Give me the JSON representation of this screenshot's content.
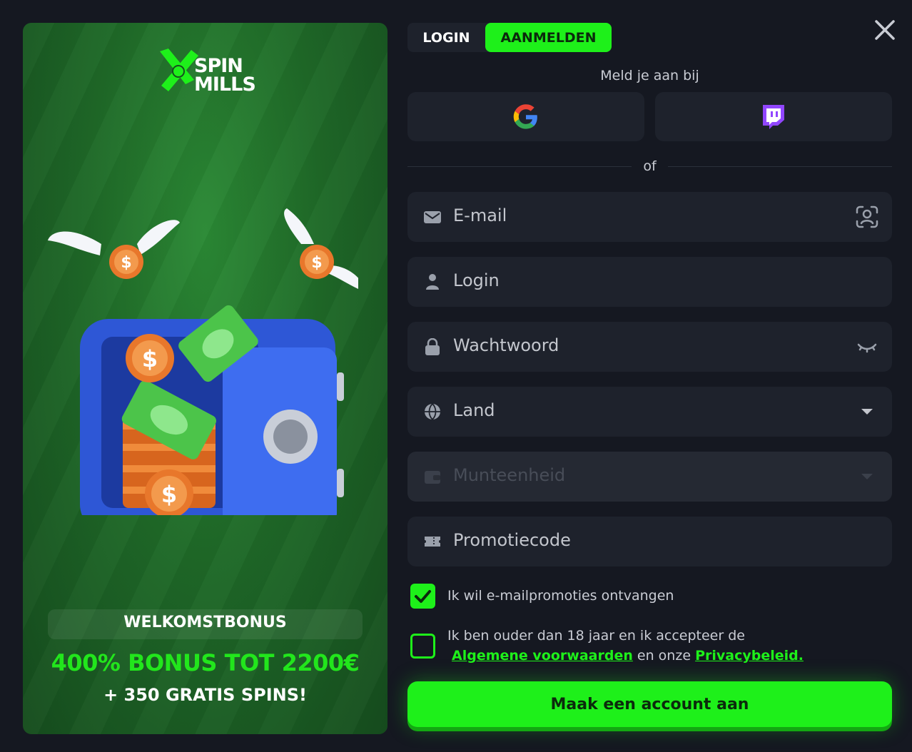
{
  "promo": {
    "logo_line1": "SPIN",
    "logo_line2": "MILLS",
    "bonus_title": "WELKOMSTBONUS",
    "bonus_main": "400% BONUS TOT 2200€",
    "bonus_sub": "+ 350 GRATIS SPINS!"
  },
  "tabs": {
    "login": "LOGIN",
    "signup": "AANMELDEN"
  },
  "subtitle": "Meld je aan bij",
  "divider_text": "of",
  "fields": {
    "email": "E-mail",
    "login": "Login",
    "password": "Wachtwoord",
    "country": "Land",
    "currency": "Munteenheid",
    "promo": "Promotiecode"
  },
  "checks": {
    "promo_text": "Ik wil e-mailpromoties ontvangen",
    "terms_text_1": "Ik ben ouder dan 18 jaar en ik accepteer de",
    "terms_link": "Algemene voorwaarden",
    "terms_mid": "en onze",
    "privacy_link": "Privacybeleid."
  },
  "submit": "Maak een account aan",
  "colors": {
    "accent": "#1ef01a",
    "background": "#151821",
    "field": "#1e222c",
    "promo_green": "#1f6a28"
  },
  "icons": [
    "close-icon",
    "google-icon",
    "twitch-icon",
    "mail-icon",
    "face-id-icon",
    "user-icon",
    "lock-icon",
    "eye-closed-icon",
    "globe-icon",
    "chevron-down-icon",
    "wallet-icon",
    "ticket-icon",
    "check-icon"
  ]
}
